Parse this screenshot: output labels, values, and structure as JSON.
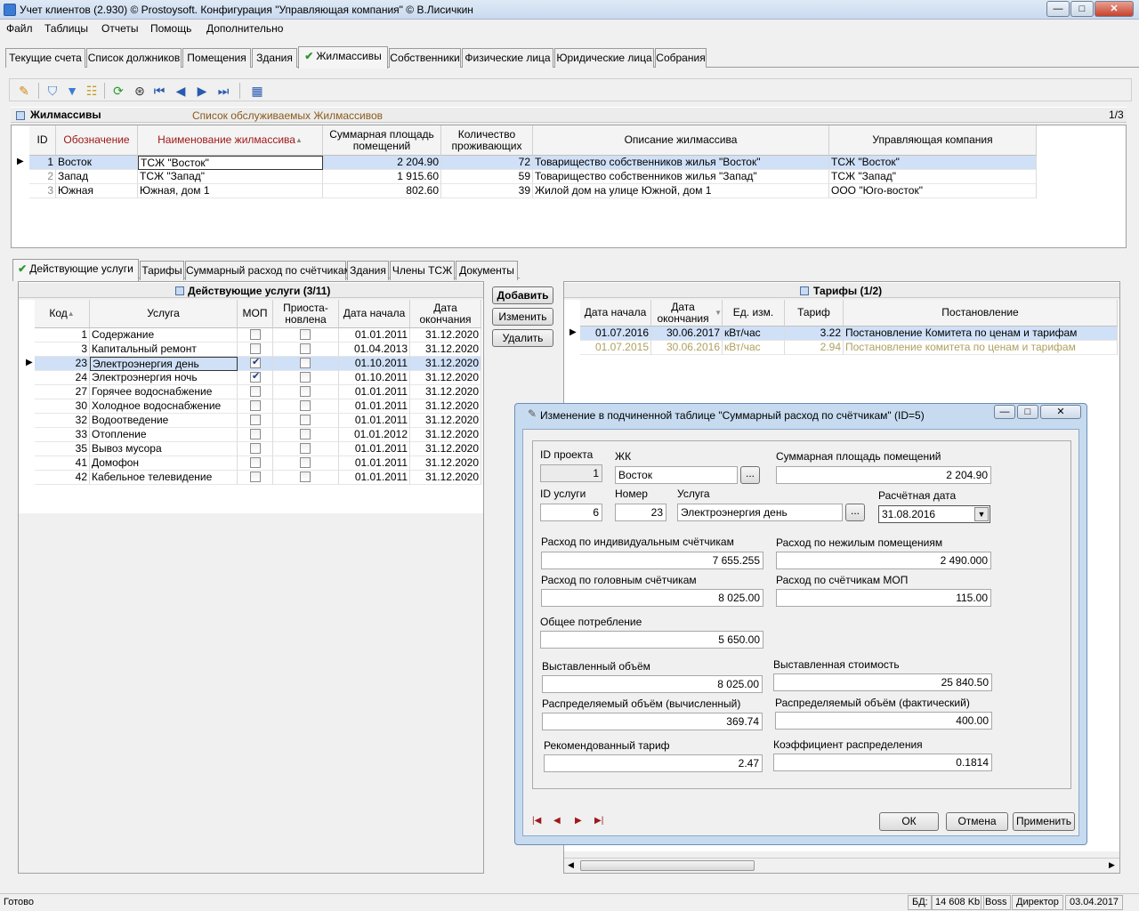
{
  "window": {
    "title": "Учет клиентов (2.930) © Prostoysoft. Конфигурация \"Управляющая компания\" © В.Лисичкин",
    "min": "—",
    "max": "□",
    "close": "✕"
  },
  "menu": [
    "Файл",
    "Таблицы",
    "Отчеты",
    "Помощь",
    "Дополнительно"
  ],
  "tabs": [
    "Текущие счета",
    "Список должников",
    "Помещения",
    "Здания",
    "Жилмассивы",
    "Собственники",
    "Физические лица",
    "Юридические лица",
    "Собрания"
  ],
  "panel": {
    "title": "Жилмассивы",
    "subtitle": "Список обслуживаемых Жилмассивов",
    "counter": "1/3"
  },
  "estates": {
    "headers": [
      "ID",
      "Обозначение",
      "Наименование жилмассива",
      "Суммарная площадь помещений",
      "Количество проживающих",
      "Описание жилмассива",
      "Управляющая компания"
    ],
    "rows": [
      [
        "1",
        "Восток",
        "ТСЖ \"Восток\"",
        "2 204.90",
        "72",
        "Товарищество собственников жилья \"Восток\"",
        "ТСЖ \"Восток\""
      ],
      [
        "2",
        "Запад",
        "ТСЖ \"Запад\"",
        "1 915.60",
        "59",
        "Товарищество собственников жилья \"Запад\"",
        "ТСЖ \"Запад\""
      ],
      [
        "3",
        "Южная",
        "Южная, дом 1",
        "802.60",
        "39",
        "Жилой дом на улице Южной, дом 1",
        "ООО \"Юго-восток\""
      ]
    ]
  },
  "subtabs": [
    "Действующие услуги",
    "Тарифы",
    "Суммарный расход по счётчикам",
    "Здания",
    "Члены ТСЖ",
    "Документы"
  ],
  "services": {
    "title": "Действующие услуги (3/11)",
    "headers": [
      "Код",
      "Услуга",
      "МОП",
      "Приоста-новлена",
      "Дата начала",
      "Дата окончания"
    ],
    "rows": [
      [
        "1",
        "Содержание",
        false,
        false,
        "01.01.2011",
        "31.12.2020"
      ],
      [
        "3",
        "Капитальный ремонт",
        false,
        false,
        "01.04.2013",
        "31.12.2020"
      ],
      [
        "23",
        "Электроэнергия день",
        true,
        false,
        "01.10.2011",
        "31.12.2020"
      ],
      [
        "24",
        "Электроэнергия ночь",
        true,
        false,
        "01.10.2011",
        "31.12.2020"
      ],
      [
        "27",
        "Горячее водоснабжение",
        false,
        false,
        "01.01.2011",
        "31.12.2020"
      ],
      [
        "30",
        "Холодное водоснабжение",
        false,
        false,
        "01.01.2011",
        "31.12.2020"
      ],
      [
        "32",
        "Водоотведение",
        false,
        false,
        "01.01.2011",
        "31.12.2020"
      ],
      [
        "33",
        "Отопление",
        false,
        false,
        "01.01.2012",
        "31.12.2020"
      ],
      [
        "35",
        "Вывоз мусора",
        false,
        false,
        "01.01.2011",
        "31.12.2020"
      ],
      [
        "41",
        "Домофон",
        false,
        false,
        "01.01.2011",
        "31.12.2020"
      ],
      [
        "42",
        "Кабельное телевидение",
        false,
        false,
        "01.01.2011",
        "31.12.2020"
      ]
    ]
  },
  "buttons": {
    "add": "Добавить",
    "edit": "Изменить",
    "delete": "Удалить"
  },
  "tariffs": {
    "title": "Тарифы (1/2)",
    "headers": [
      "Дата начала",
      "Дата окончания",
      "Ед. изм.",
      "Тариф",
      "Постановление"
    ],
    "rows": [
      [
        "01.07.2016",
        "30.06.2017",
        "кВт/час",
        "3.22",
        "Постановление Комитета по ценам и тарифам"
      ],
      [
        "01.07.2015",
        "30.06.2016",
        "кВт/час",
        "2.94",
        "Постановление комитета по ценам и тарифам"
      ]
    ]
  },
  "dialog": {
    "title": "Изменение в подчиненной таблице \"Суммарный расход по счётчикам\" (ID=5)",
    "fields": {
      "project_id_label": "ID проекта",
      "project_id": "1",
      "zhk_label": "ЖК",
      "zhk": "Восток",
      "area_label": "Суммарная площадь помещений",
      "area": "2 204.90",
      "service_id_label": "ID услуги",
      "service_id": "6",
      "number_label": "Номер",
      "number": "23",
      "service_label": "Услуга",
      "service": "Электроэнергия день",
      "calc_date_label": "Расчётная дата",
      "calc_date": "31.08.2016",
      "individual_label": "Расход по индивидуальным счётчикам",
      "individual": "7 655.255",
      "nonres_label": "Расход по нежилым помещениям",
      "nonres": "2 490.000",
      "main_label": "Расход по головным счётчикам",
      "main": "8 025.00",
      "mop_label": "Расход по счётчикам МОП",
      "mop": "115.00",
      "total_label": "Общее потребление",
      "total": "5 650.00",
      "billed_vol_label": "Выставленный объём",
      "billed_vol": "8 025.00",
      "billed_cost_label": "Выставленная стоимость",
      "billed_cost": "25 840.50",
      "dist_calc_label": "Распределяемый объём (вычисленный)",
      "dist_calc": "369.74",
      "dist_fact_label": "Распределяемый объём (фактический)",
      "dist_fact": "400.00",
      "rec_tariff_label": "Рекомендованный тариф",
      "rec_tariff": "2.47",
      "coef_label": "Коэффициент распределения",
      "coef": "0.1814"
    },
    "ok": "ОК",
    "cancel": "Отмена",
    "apply": "Применить",
    "browse": "..."
  },
  "status": {
    "text": "Готово",
    "db": "БД:",
    "size": "14 608 Kb",
    "user": "Boss",
    "role": "Директор",
    "date": "03.04.2017"
  },
  "colors": {
    "accent": "#3a7bd5",
    "selection": "#cfe0f7",
    "header_red": "#a01818"
  }
}
